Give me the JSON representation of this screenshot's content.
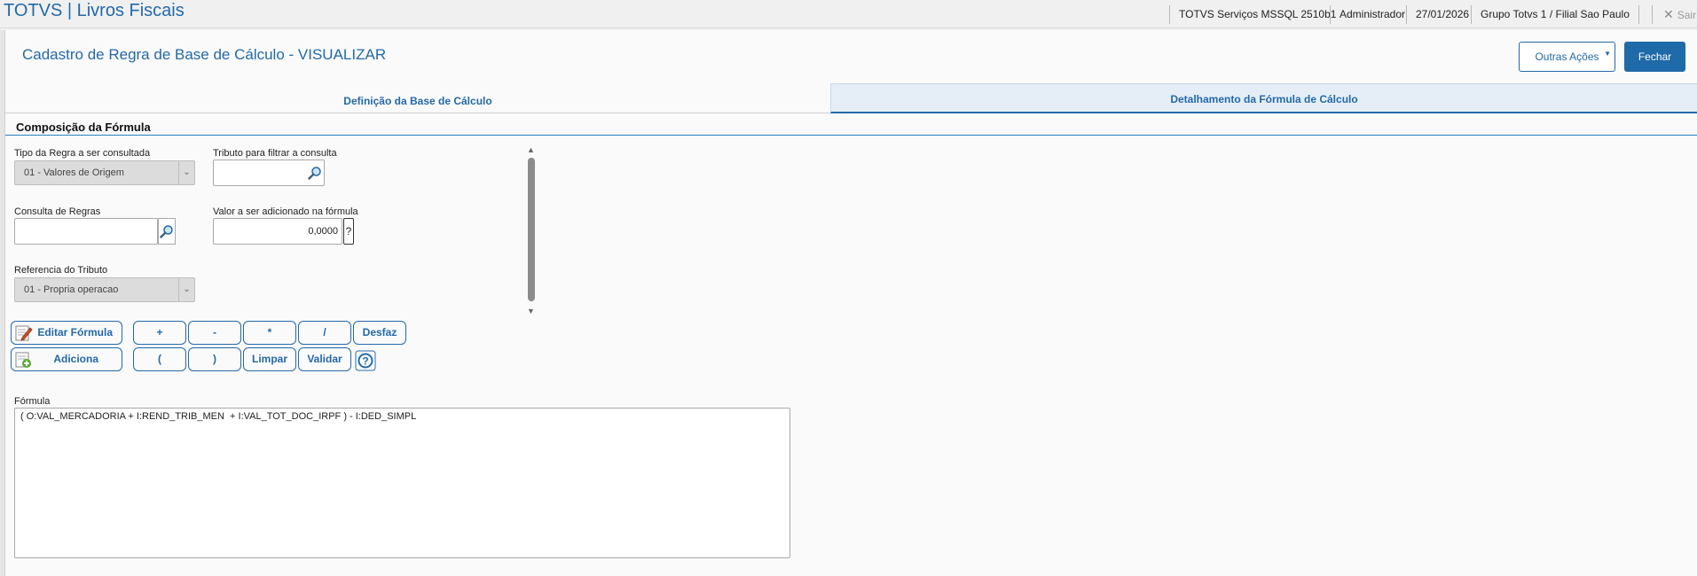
{
  "header": {
    "app_title": "TOTVS | Livros Fiscais",
    "environment": "TOTVS Serviços MSSQL 2510b1",
    "user": "Administrador",
    "date": "27/01/2026",
    "company": "Grupo Totvs 1 / Filial Sao Paulo",
    "exit_label": "Sair"
  },
  "page": {
    "title": "Cadastro de Regra de Base de Cálculo - VISUALIZAR",
    "other_actions_label": "Outras Ações",
    "close_label": "Fechar"
  },
  "tabs": [
    {
      "label": "Definição da Base de Cálculo",
      "active": false
    },
    {
      "label": "Detalhamento da Fórmula de Cálculo",
      "active": true
    }
  ],
  "section": {
    "title": "Composição da Fórmula"
  },
  "fields": {
    "tipo_regra": {
      "label": "Tipo da Regra a ser consultada",
      "value": "01 - Valores de Origem"
    },
    "tributo_filtro": {
      "label": "Tributo para filtrar a consulta",
      "value": ""
    },
    "consulta_regras": {
      "label": "Consulta de Regras",
      "value": ""
    },
    "valor_adicionado": {
      "label": "Valor a ser adicionado na fórmula",
      "value": "0,0000",
      "help": "?"
    },
    "referencia_tributo": {
      "label": "Referencia do Tributo",
      "value": "01 - Propria operacao"
    }
  },
  "formula_buttons": {
    "edit": "Editar Fórmula",
    "add": "Adiciona",
    "plus": "+",
    "minus": "-",
    "times": "*",
    "divide": "/",
    "undo": "Desfaz",
    "open_paren": "(",
    "close_paren": ")",
    "clear": "Limpar",
    "validate": "Validar"
  },
  "formula": {
    "label": "Fórmula",
    "value": "( O:VAL_MERCADORIA + I:REND_TRIB_MEN  + I:VAL_TOT_DOC_IRPF ) - I:DED_SIMPL"
  },
  "colors": {
    "accent": "#2469a8",
    "primary_button": "#1f6aa8"
  }
}
